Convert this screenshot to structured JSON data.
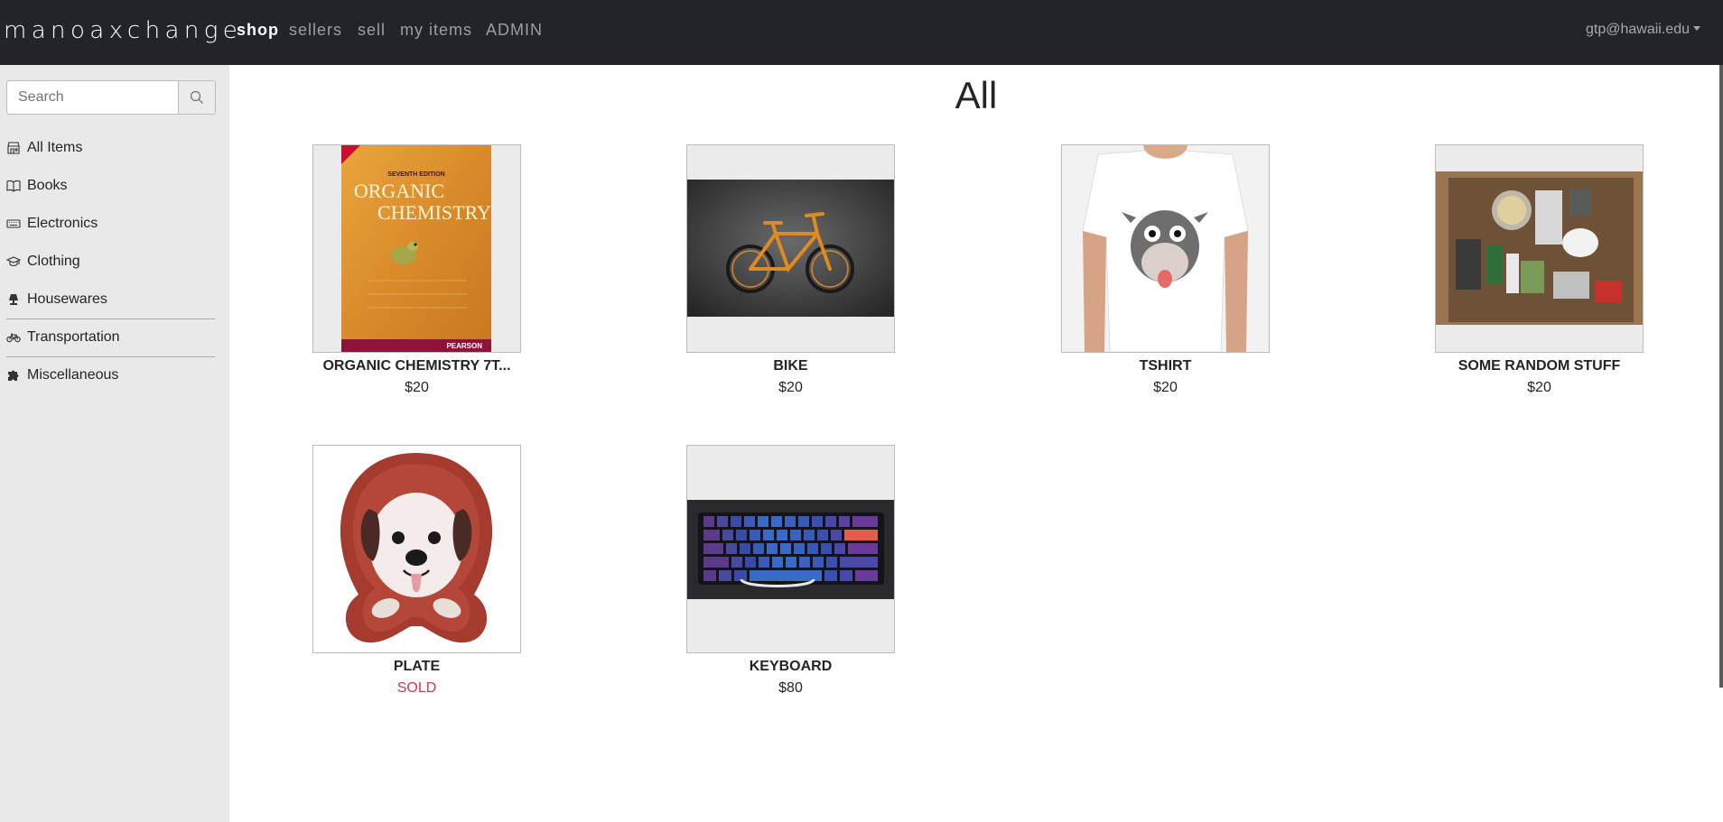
{
  "nav": {
    "brand": "manoaxchange",
    "links": [
      "shop",
      "sellers",
      "sell",
      "my items",
      "ADMIN"
    ],
    "active": "shop",
    "user": "gtp@hawaii.edu"
  },
  "sidebar": {
    "search_placeholder": "Search",
    "categories": [
      {
        "label": "All Items",
        "icon": "store-icon"
      },
      {
        "label": "Books",
        "icon": "book-icon"
      },
      {
        "label": "Electronics",
        "icon": "keyboard-icon"
      },
      {
        "label": "Clothing",
        "icon": "graduation-cap-icon"
      },
      {
        "label": "Housewares",
        "icon": "lamp-icon"
      },
      {
        "label": "Transportation",
        "icon": "bicycle-icon"
      },
      {
        "label": "Miscellaneous",
        "icon": "puzzle-icon"
      }
    ]
  },
  "main": {
    "title": "All",
    "items": [
      {
        "name": "ORGANIC CHEMISTRY 7T...",
        "price": "$20",
        "sold": false
      },
      {
        "name": "BIKE",
        "price": "$20",
        "sold": false
      },
      {
        "name": "TSHIRT",
        "price": "$20",
        "sold": false
      },
      {
        "name": "SOME RANDOM STUFF",
        "price": "$20",
        "sold": false
      },
      {
        "name": "PLATE",
        "price": "SOLD",
        "sold": true
      },
      {
        "name": "KEYBOARD",
        "price": "$80",
        "sold": false
      }
    ],
    "book_cover": {
      "edition": "SEVENTH EDITION",
      "title_line1": "ORGANIC",
      "title_line2": "CHEMISTRY",
      "publisher": "PEARSON"
    }
  }
}
